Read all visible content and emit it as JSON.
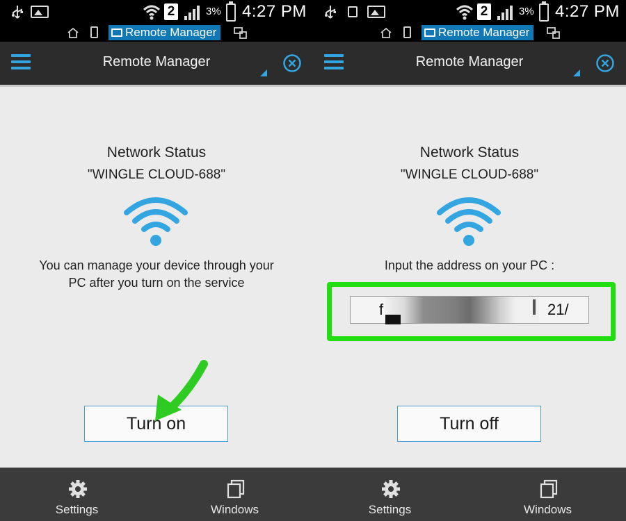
{
  "status_bar": {
    "sim_badge": "2",
    "battery": "3%",
    "time": "4:27 PM"
  },
  "notification": {
    "app_label": "Remote Manager"
  },
  "app_bar": {
    "title": "Remote Manager"
  },
  "network": {
    "title": "Network Status",
    "ssid": "\"WINGLE CLOUD-688\""
  },
  "left_panel": {
    "description_line1": "You can manage your device through your",
    "description_line2": "PC after you turn on the service",
    "button_label": "Turn on"
  },
  "right_panel": {
    "instruction": "Input the address on your PC :",
    "address_visible_start": "f",
    "address_visible_end": "21/",
    "button_label": "Turn off"
  },
  "bottom_nav": {
    "items": [
      {
        "label": "Settings",
        "icon": "gear-icon"
      },
      {
        "label": "Windows",
        "icon": "windows-icon"
      }
    ]
  },
  "colors": {
    "accent": "#33a5e0",
    "highlight": "#22dd11",
    "app_bar": "#2c2c2c",
    "bottom_bar": "#3b3b3b",
    "notification_pill": "#0f78b5"
  }
}
